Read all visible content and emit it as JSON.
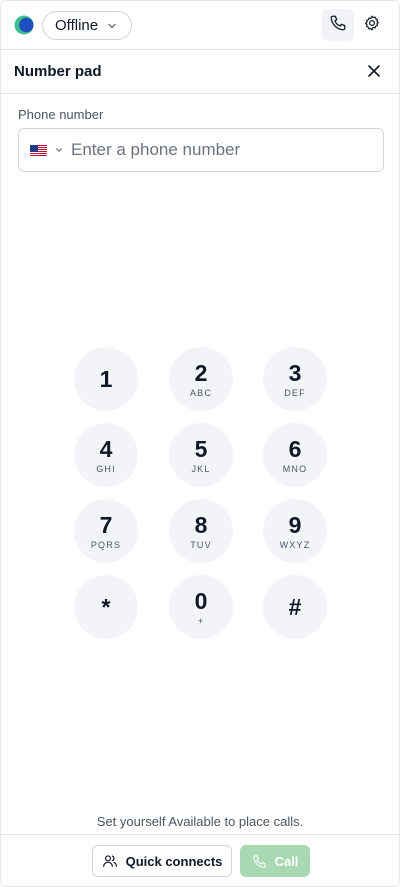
{
  "header": {
    "status_label": "Offline",
    "icons": {
      "logo": "app-logo",
      "status_chevron": "chevron-down-icon",
      "phone": "phone-icon",
      "settings": "gear-icon"
    }
  },
  "panel": {
    "title": "Number pad",
    "close_icon": "close-icon"
  },
  "phone_field": {
    "label": "Phone number",
    "placeholder": "Enter a phone number",
    "value": "",
    "country_flag": "us-flag-icon"
  },
  "keypad": [
    {
      "digit": "1",
      "letters": ""
    },
    {
      "digit": "2",
      "letters": "ABC"
    },
    {
      "digit": "3",
      "letters": "DEF"
    },
    {
      "digit": "4",
      "letters": "GHI"
    },
    {
      "digit": "5",
      "letters": "JKL"
    },
    {
      "digit": "6",
      "letters": "MNO"
    },
    {
      "digit": "7",
      "letters": "PQRS"
    },
    {
      "digit": "8",
      "letters": "TUV"
    },
    {
      "digit": "9",
      "letters": "WXYZ"
    },
    {
      "digit": "*",
      "letters": ""
    },
    {
      "digit": "0",
      "letters": "+"
    },
    {
      "digit": "#",
      "letters": ""
    }
  ],
  "footer": {
    "hint": "Set yourself Available to place calls.",
    "quick_connects_label": "Quick connects",
    "call_label": "Call"
  },
  "colors": {
    "call_button_disabled": "#a9d9b3",
    "key_background": "#f3f4f8",
    "logo_green": "#3fbf8f",
    "logo_blue": "#1f4fbf"
  }
}
